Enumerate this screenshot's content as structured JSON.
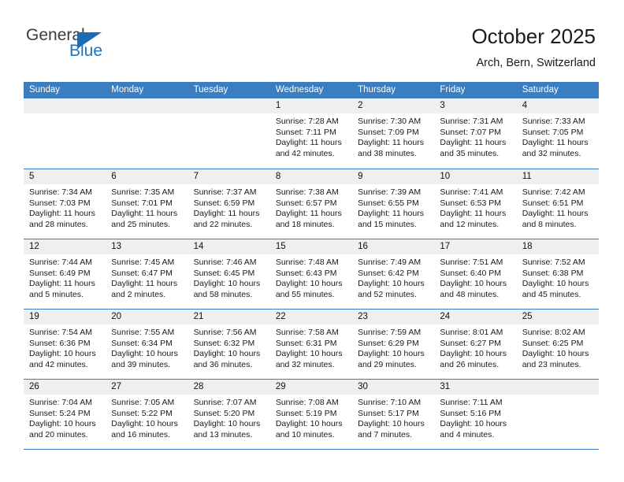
{
  "brand": {
    "general": "General",
    "blue": "Blue",
    "triangle_color": "#1b6cb0",
    "blue_color": "#1b75bb"
  },
  "header": {
    "title": "October 2025",
    "subtitle": "Arch, Bern, Switzerland"
  },
  "theme": {
    "header_row_bg": "#3a7dc0",
    "day_number_bg": "#efefef",
    "row_divider": "#3a7dc0"
  },
  "weekday_headers": [
    "Sunday",
    "Monday",
    "Tuesday",
    "Wednesday",
    "Thursday",
    "Friday",
    "Saturday"
  ],
  "weeks": [
    [
      {
        "day": "",
        "sunrise": "",
        "sunset": "",
        "daylight1": "",
        "daylight2": "",
        "empty": true
      },
      {
        "day": "",
        "sunrise": "",
        "sunset": "",
        "daylight1": "",
        "daylight2": "",
        "empty": true
      },
      {
        "day": "",
        "sunrise": "",
        "sunset": "",
        "daylight1": "",
        "daylight2": "",
        "empty": true
      },
      {
        "day": "1",
        "sunrise": "Sunrise: 7:28 AM",
        "sunset": "Sunset: 7:11 PM",
        "daylight1": "Daylight: 11 hours",
        "daylight2": "and 42 minutes."
      },
      {
        "day": "2",
        "sunrise": "Sunrise: 7:30 AM",
        "sunset": "Sunset: 7:09 PM",
        "daylight1": "Daylight: 11 hours",
        "daylight2": "and 38 minutes."
      },
      {
        "day": "3",
        "sunrise": "Sunrise: 7:31 AM",
        "sunset": "Sunset: 7:07 PM",
        "daylight1": "Daylight: 11 hours",
        "daylight2": "and 35 minutes."
      },
      {
        "day": "4",
        "sunrise": "Sunrise: 7:33 AM",
        "sunset": "Sunset: 7:05 PM",
        "daylight1": "Daylight: 11 hours",
        "daylight2": "and 32 minutes."
      }
    ],
    [
      {
        "day": "5",
        "sunrise": "Sunrise: 7:34 AM",
        "sunset": "Sunset: 7:03 PM",
        "daylight1": "Daylight: 11 hours",
        "daylight2": "and 28 minutes."
      },
      {
        "day": "6",
        "sunrise": "Sunrise: 7:35 AM",
        "sunset": "Sunset: 7:01 PM",
        "daylight1": "Daylight: 11 hours",
        "daylight2": "and 25 minutes."
      },
      {
        "day": "7",
        "sunrise": "Sunrise: 7:37 AM",
        "sunset": "Sunset: 6:59 PM",
        "daylight1": "Daylight: 11 hours",
        "daylight2": "and 22 minutes."
      },
      {
        "day": "8",
        "sunrise": "Sunrise: 7:38 AM",
        "sunset": "Sunset: 6:57 PM",
        "daylight1": "Daylight: 11 hours",
        "daylight2": "and 18 minutes."
      },
      {
        "day": "9",
        "sunrise": "Sunrise: 7:39 AM",
        "sunset": "Sunset: 6:55 PM",
        "daylight1": "Daylight: 11 hours",
        "daylight2": "and 15 minutes."
      },
      {
        "day": "10",
        "sunrise": "Sunrise: 7:41 AM",
        "sunset": "Sunset: 6:53 PM",
        "daylight1": "Daylight: 11 hours",
        "daylight2": "and 12 minutes."
      },
      {
        "day": "11",
        "sunrise": "Sunrise: 7:42 AM",
        "sunset": "Sunset: 6:51 PM",
        "daylight1": "Daylight: 11 hours",
        "daylight2": "and 8 minutes."
      }
    ],
    [
      {
        "day": "12",
        "sunrise": "Sunrise: 7:44 AM",
        "sunset": "Sunset: 6:49 PM",
        "daylight1": "Daylight: 11 hours",
        "daylight2": "and 5 minutes."
      },
      {
        "day": "13",
        "sunrise": "Sunrise: 7:45 AM",
        "sunset": "Sunset: 6:47 PM",
        "daylight1": "Daylight: 11 hours",
        "daylight2": "and 2 minutes."
      },
      {
        "day": "14",
        "sunrise": "Sunrise: 7:46 AM",
        "sunset": "Sunset: 6:45 PM",
        "daylight1": "Daylight: 10 hours",
        "daylight2": "and 58 minutes."
      },
      {
        "day": "15",
        "sunrise": "Sunrise: 7:48 AM",
        "sunset": "Sunset: 6:43 PM",
        "daylight1": "Daylight: 10 hours",
        "daylight2": "and 55 minutes."
      },
      {
        "day": "16",
        "sunrise": "Sunrise: 7:49 AM",
        "sunset": "Sunset: 6:42 PM",
        "daylight1": "Daylight: 10 hours",
        "daylight2": "and 52 minutes."
      },
      {
        "day": "17",
        "sunrise": "Sunrise: 7:51 AM",
        "sunset": "Sunset: 6:40 PM",
        "daylight1": "Daylight: 10 hours",
        "daylight2": "and 48 minutes."
      },
      {
        "day": "18",
        "sunrise": "Sunrise: 7:52 AM",
        "sunset": "Sunset: 6:38 PM",
        "daylight1": "Daylight: 10 hours",
        "daylight2": "and 45 minutes."
      }
    ],
    [
      {
        "day": "19",
        "sunrise": "Sunrise: 7:54 AM",
        "sunset": "Sunset: 6:36 PM",
        "daylight1": "Daylight: 10 hours",
        "daylight2": "and 42 minutes."
      },
      {
        "day": "20",
        "sunrise": "Sunrise: 7:55 AM",
        "sunset": "Sunset: 6:34 PM",
        "daylight1": "Daylight: 10 hours",
        "daylight2": "and 39 minutes."
      },
      {
        "day": "21",
        "sunrise": "Sunrise: 7:56 AM",
        "sunset": "Sunset: 6:32 PM",
        "daylight1": "Daylight: 10 hours",
        "daylight2": "and 36 minutes."
      },
      {
        "day": "22",
        "sunrise": "Sunrise: 7:58 AM",
        "sunset": "Sunset: 6:31 PM",
        "daylight1": "Daylight: 10 hours",
        "daylight2": "and 32 minutes."
      },
      {
        "day": "23",
        "sunrise": "Sunrise: 7:59 AM",
        "sunset": "Sunset: 6:29 PM",
        "daylight1": "Daylight: 10 hours",
        "daylight2": "and 29 minutes."
      },
      {
        "day": "24",
        "sunrise": "Sunrise: 8:01 AM",
        "sunset": "Sunset: 6:27 PM",
        "daylight1": "Daylight: 10 hours",
        "daylight2": "and 26 minutes."
      },
      {
        "day": "25",
        "sunrise": "Sunrise: 8:02 AM",
        "sunset": "Sunset: 6:25 PM",
        "daylight1": "Daylight: 10 hours",
        "daylight2": "and 23 minutes."
      }
    ],
    [
      {
        "day": "26",
        "sunrise": "Sunrise: 7:04 AM",
        "sunset": "Sunset: 5:24 PM",
        "daylight1": "Daylight: 10 hours",
        "daylight2": "and 20 minutes."
      },
      {
        "day": "27",
        "sunrise": "Sunrise: 7:05 AM",
        "sunset": "Sunset: 5:22 PM",
        "daylight1": "Daylight: 10 hours",
        "daylight2": "and 16 minutes."
      },
      {
        "day": "28",
        "sunrise": "Sunrise: 7:07 AM",
        "sunset": "Sunset: 5:20 PM",
        "daylight1": "Daylight: 10 hours",
        "daylight2": "and 13 minutes."
      },
      {
        "day": "29",
        "sunrise": "Sunrise: 7:08 AM",
        "sunset": "Sunset: 5:19 PM",
        "daylight1": "Daylight: 10 hours",
        "daylight2": "and 10 minutes."
      },
      {
        "day": "30",
        "sunrise": "Sunrise: 7:10 AM",
        "sunset": "Sunset: 5:17 PM",
        "daylight1": "Daylight: 10 hours",
        "daylight2": "and 7 minutes."
      },
      {
        "day": "31",
        "sunrise": "Sunrise: 7:11 AM",
        "sunset": "Sunset: 5:16 PM",
        "daylight1": "Daylight: 10 hours",
        "daylight2": "and 4 minutes."
      },
      {
        "day": "",
        "sunrise": "",
        "sunset": "",
        "daylight1": "",
        "daylight2": "",
        "empty": true
      }
    ]
  ]
}
